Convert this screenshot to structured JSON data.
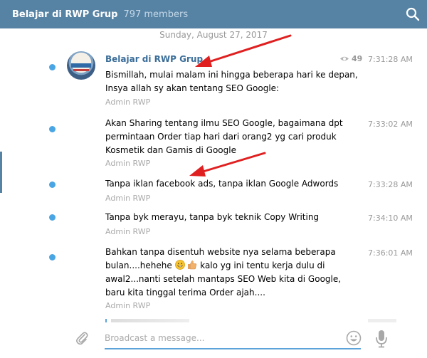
{
  "header": {
    "title": "Belajar di RWP Grup",
    "members": "797 members"
  },
  "date_separator": "Sunday, August 27, 2017",
  "messages": [
    {
      "author": "Belajar di RWP Grup",
      "views": "49",
      "time": "7:31:28 AM",
      "text": "Bismillah, mulai malam ini hingga beberapa hari ke depan, Insya allah sy akan tentang SEO Google:",
      "signature": "Admin RWP"
    },
    {
      "time": "7:33:02 AM",
      "text": "Akan Sharing tentang ilmu SEO Google,  bagaimana dpt permintaan Order tiap hari dari orang2 yg cari produk Kosmetik dan  Gamis di Google",
      "signature": "Admin RWP"
    },
    {
      "time": "7:33:28 AM",
      "text": "Tanpa iklan facebook ads, tanpa iklan Google Adwords",
      "signature": "Admin RWP"
    },
    {
      "time": "7:34:10 AM",
      "text": "Tanpa byk merayu, tanpa byk teknik Copy Writing",
      "signature": "Admin RWP"
    },
    {
      "time": "7:36:01 AM",
      "text_before": "Bahkan tanpa disentuh website nya selama beberapa bulan....hehehe ",
      "text_after": " kalo yg ini tentu kerja dulu di awal2...nanti setelah mantaps SEO Web kita di Google,  baru kita tinggal terima Order ajah....",
      "signature": "Admin RWP"
    }
  ],
  "composer": {
    "placeholder": "Broadcast a message..."
  },
  "colors": {
    "header_bg": "#5682a3",
    "unread_dot": "#4aa5e4",
    "author": "#3a6d99",
    "annotation_arrow": "#e02020"
  },
  "icons": {
    "search": "search-icon",
    "views": "eye-icon",
    "attach": "paperclip-icon",
    "emoji": "smiley-icon",
    "mic": "microphone-icon"
  }
}
